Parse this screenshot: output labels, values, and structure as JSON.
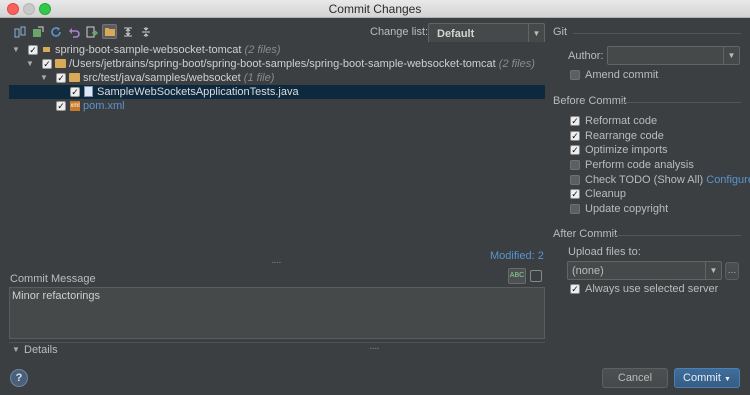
{
  "window": {
    "title": "Commit Changes"
  },
  "toolbar": {
    "icons": [
      "diff-icon",
      "move-to-changelist-icon",
      "refresh-icon",
      "rollback-icon",
      "jump-to-source-icon",
      "group-by-directory-icon",
      "expand-all-icon",
      "collapse-all-icon"
    ]
  },
  "changelist": {
    "label": "Change list:",
    "value": "Default"
  },
  "tree": {
    "root": {
      "name": "spring-boot-sample-websocket-tomcat",
      "count": "(2 files)"
    },
    "dir": {
      "name": "/Users/jetbrains/spring-boot/spring-boot-samples/spring-boot-sample-websocket-tomcat",
      "count": "(2 files)"
    },
    "subdir": {
      "name": "src/test/java/samples/websocket",
      "count": "(1 file)"
    },
    "file1": {
      "name": "SampleWebSocketsApplicationTests.java"
    },
    "file2": {
      "name": "pom.xml"
    }
  },
  "modified": "Modified: 2",
  "commit_message": {
    "label": "Commit Message",
    "value": "Minor refactorings"
  },
  "details": {
    "label": "Details"
  },
  "git": {
    "section": "Git",
    "author_label": "Author:",
    "author_value": "",
    "amend": {
      "label": "Amend commit",
      "checked": false
    }
  },
  "before_commit": {
    "section": "Before Commit",
    "options": [
      {
        "label": "Reformat code",
        "checked": true
      },
      {
        "label": "Rearrange code",
        "checked": true
      },
      {
        "label": "Optimize imports",
        "checked": true
      },
      {
        "label": "Perform code analysis",
        "checked": false
      },
      {
        "label": "Check TODO (Show All)",
        "checked": false,
        "link": "Configure"
      },
      {
        "label": "Cleanup",
        "checked": true
      },
      {
        "label": "Update copyright",
        "checked": false
      }
    ]
  },
  "after_commit": {
    "section": "After Commit",
    "upload_label": "Upload files to:",
    "upload_value": "(none)",
    "always_use": {
      "label": "Always use selected server",
      "checked": true
    }
  },
  "buttons": {
    "help": "?",
    "cancel": "Cancel",
    "commit": "Commit"
  },
  "colors": {
    "background": "#3c3f41",
    "selection": "#0d293e",
    "link": "#5894d1",
    "primary_button": "#365d85"
  }
}
